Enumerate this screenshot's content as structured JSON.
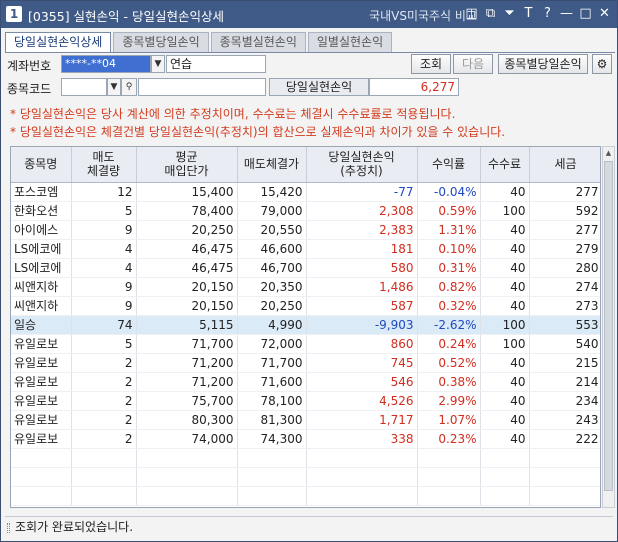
{
  "window": {
    "logo": "1",
    "title": "[0355] 실현손익 - 당일실현손익상세",
    "right_link": "국내VS미국주식 비교"
  },
  "tabs": [
    {
      "label": "당일실현손익상세"
    },
    {
      "label": "종목별당일손익"
    },
    {
      "label": "종목별실현손익"
    },
    {
      "label": "일별실현손익"
    }
  ],
  "form": {
    "account_label": "계좌번호",
    "account_value": "****-**04",
    "account_name": "연습",
    "code_label": "종목코드",
    "code_value": "",
    "pnl_label": "당일실현손익",
    "pnl_value": "6,277",
    "query_button": "조회",
    "next_button": "다음",
    "by_stock_button": "종목별당일손익"
  },
  "notes": [
    "* 당일실현손익은 당사 계산에 의한 추정치이며, 수수료는 체결시 수수료률로 적용됩니다.",
    "* 당일실현손익은 체결건별 당일실현손익(추정치)의 합산으로 실제손익과 차이가 있을 수 있습니다."
  ],
  "table": {
    "headers": [
      "종목명",
      "매도\n체결량",
      "평균\n매입단가",
      "매도체결가",
      "당일실현손익\n(추정치)",
      "수익률",
      "수수료",
      "세금"
    ],
    "rows": [
      {
        "name": "포스코엠",
        "qty": "12",
        "avg": "15,400",
        "sell": "15,420",
        "pnl": "-77",
        "rate": "-0.04%",
        "fee": "40",
        "tax": "277",
        "sign": "neg"
      },
      {
        "name": "한화오션",
        "qty": "5",
        "avg": "78,400",
        "sell": "79,000",
        "pnl": "2,308",
        "rate": "0.59%",
        "fee": "100",
        "tax": "592",
        "sign": "pos"
      },
      {
        "name": "아이에스",
        "qty": "9",
        "avg": "20,250",
        "sell": "20,550",
        "pnl": "2,383",
        "rate": "1.31%",
        "fee": "40",
        "tax": "277",
        "sign": "pos"
      },
      {
        "name": "LS에코에",
        "qty": "4",
        "avg": "46,475",
        "sell": "46,600",
        "pnl": "181",
        "rate": "0.10%",
        "fee": "40",
        "tax": "279",
        "sign": "pos"
      },
      {
        "name": "LS에코에",
        "qty": "4",
        "avg": "46,475",
        "sell": "46,700",
        "pnl": "580",
        "rate": "0.31%",
        "fee": "40",
        "tax": "280",
        "sign": "pos"
      },
      {
        "name": "씨앤지하",
        "qty": "9",
        "avg": "20,150",
        "sell": "20,350",
        "pnl": "1,486",
        "rate": "0.82%",
        "fee": "40",
        "tax": "274",
        "sign": "pos"
      },
      {
        "name": "씨앤지하",
        "qty": "9",
        "avg": "20,150",
        "sell": "20,250",
        "pnl": "587",
        "rate": "0.32%",
        "fee": "40",
        "tax": "273",
        "sign": "pos"
      },
      {
        "name": "일승",
        "qty": "74",
        "avg": "5,115",
        "sell": "4,990",
        "pnl": "-9,903",
        "rate": "-2.62%",
        "fee": "100",
        "tax": "553",
        "sign": "neg",
        "highlight": true
      },
      {
        "name": "유일로보",
        "qty": "5",
        "avg": "71,700",
        "sell": "72,000",
        "pnl": "860",
        "rate": "0.24%",
        "fee": "100",
        "tax": "540",
        "sign": "pos"
      },
      {
        "name": "유일로보",
        "qty": "2",
        "avg": "71,200",
        "sell": "71,700",
        "pnl": "745",
        "rate": "0.52%",
        "fee": "40",
        "tax": "215",
        "sign": "pos"
      },
      {
        "name": "유일로보",
        "qty": "2",
        "avg": "71,200",
        "sell": "71,600",
        "pnl": "546",
        "rate": "0.38%",
        "fee": "40",
        "tax": "214",
        "sign": "pos"
      },
      {
        "name": "유일로보",
        "qty": "2",
        "avg": "75,700",
        "sell": "78,100",
        "pnl": "4,526",
        "rate": "2.99%",
        "fee": "40",
        "tax": "234",
        "sign": "pos"
      },
      {
        "name": "유일로보",
        "qty": "2",
        "avg": "80,300",
        "sell": "81,300",
        "pnl": "1,717",
        "rate": "1.07%",
        "fee": "40",
        "tax": "243",
        "sign": "pos"
      },
      {
        "name": "유일로보",
        "qty": "2",
        "avg": "74,000",
        "sell": "74,300",
        "pnl": "338",
        "rate": "0.23%",
        "fee": "40",
        "tax": "222",
        "sign": "pos"
      }
    ]
  },
  "status": "조회가 완료되었습니다.",
  "colors": {
    "titlebar": "#3f5a86",
    "positive": "#d22d1f",
    "negative": "#1f48c4",
    "note": "#d23b1e",
    "highlight_row": "#dbeaf7"
  },
  "icons": [
    "window-logo-icon",
    "minimize-icon",
    "restore-icon",
    "pin-icon",
    "font-size-icon",
    "help-icon",
    "maximize-icon",
    "close-icon",
    "settings-gear-icon",
    "search-icon"
  ]
}
